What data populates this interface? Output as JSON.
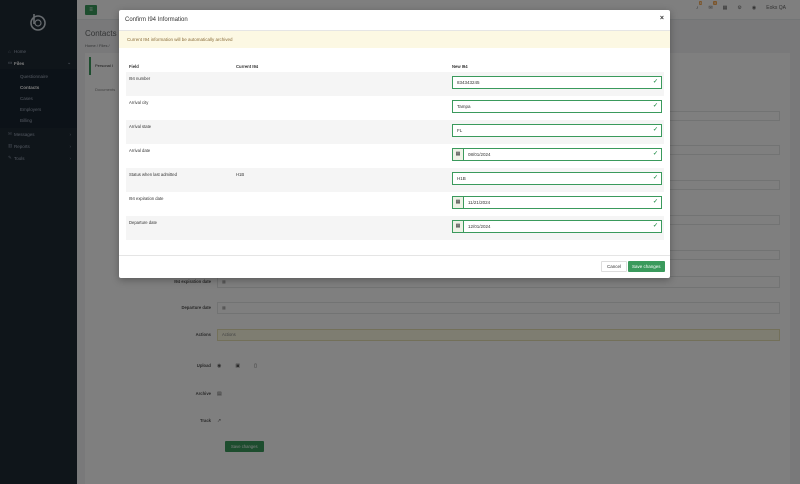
{
  "colors": {
    "accent": "#3a9a5c",
    "sidebar": "#1e2a35",
    "alert_bg": "#fcf8e3"
  },
  "sidebar": {
    "items": [
      {
        "label": "Home",
        "icon": "home-icon"
      },
      {
        "label": "Files",
        "icon": "folder-icon",
        "active": true
      },
      {
        "label": "Messages",
        "icon": "envelope-icon"
      },
      {
        "label": "Reports",
        "icon": "chart-icon"
      },
      {
        "label": "Tools",
        "icon": "wrench-icon"
      }
    ],
    "sub_items": [
      "Questionnaire",
      "Contacts",
      "Cases",
      "Employers",
      "Billing"
    ]
  },
  "topbar": {
    "user": "Eoks QA",
    "badges": [
      "4",
      "4"
    ]
  },
  "page": {
    "title": "Contacts",
    "breadcrumbs": "Home  /  Files  /",
    "tab_personal": "Personal I",
    "tab_docs": "Documents",
    "labels": {
      "i94_exp": "I94 expiration date",
      "departure": "Departure date",
      "actions": "Actions",
      "upload": "Upload",
      "archive": "Archive",
      "track": "Track"
    },
    "actions_placeholder": "Actions",
    "save_label": "Save changes"
  },
  "modal": {
    "title": "Confirm I94 Information",
    "alert": "Current I94 information will be automatically archived",
    "headers": {
      "field": "Field",
      "current": "Current I94",
      "new": "New I94"
    },
    "rows": [
      {
        "field": "I94 number",
        "current": "",
        "new": "834343245",
        "is_date": false
      },
      {
        "field": "Arrival city",
        "current": "",
        "new": "Tampa",
        "is_date": false
      },
      {
        "field": "Arrival state",
        "current": "",
        "new": "FL",
        "is_date": false
      },
      {
        "field": "Arrival date",
        "current": "",
        "new": "08/01/2024",
        "is_date": true
      },
      {
        "field": "Status when last admitted",
        "current": "H1B",
        "new": "H1B",
        "is_date": false
      },
      {
        "field": "I94 expiration date",
        "current": "",
        "new": "11/21/2024",
        "is_date": true
      },
      {
        "field": "Departure date",
        "current": "",
        "new": "12/01/2024",
        "is_date": true
      }
    ],
    "cancel": "Cancel",
    "save": "Save changes"
  }
}
